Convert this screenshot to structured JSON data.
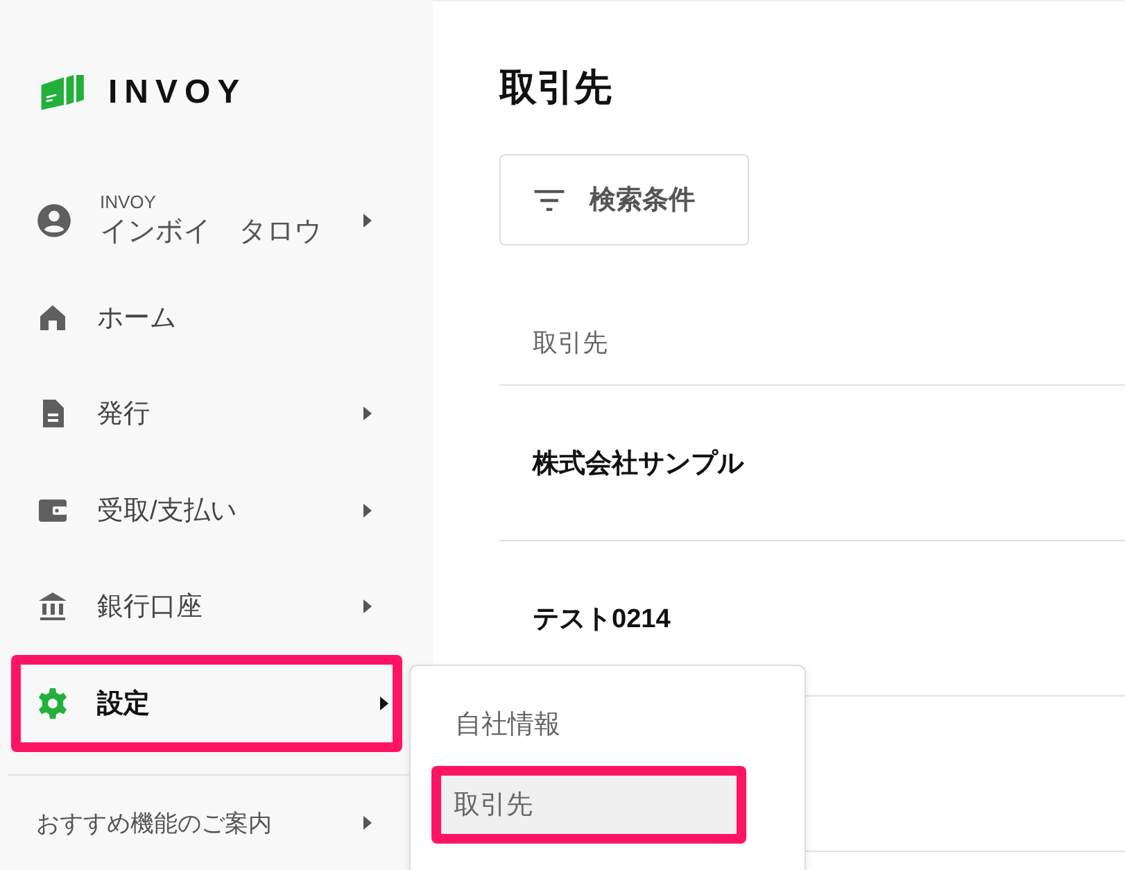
{
  "logo": {
    "text": "INVOY"
  },
  "account": {
    "company": "INVOY",
    "name": "インボイ　タロウ",
    "has_submenu": true
  },
  "nav": [
    {
      "label": "ホーム",
      "kind": "home",
      "has_submenu": false,
      "active": false,
      "highlighted": false
    },
    {
      "label": "発行",
      "kind": "document",
      "has_submenu": true,
      "active": false,
      "highlighted": false
    },
    {
      "label": "受取/支払い",
      "kind": "wallet",
      "has_submenu": true,
      "active": false,
      "highlighted": false
    },
    {
      "label": "銀行口座",
      "kind": "bank",
      "has_submenu": true,
      "active": false,
      "highlighted": false
    },
    {
      "label": "設定",
      "kind": "settings",
      "has_submenu": true,
      "active": true,
      "highlighted": true
    }
  ],
  "promo": {
    "label": "おすすめ機能のご案内",
    "has_submenu": true
  },
  "submenu": {
    "items": [
      {
        "label": "自社情報",
        "selected": false,
        "highlighted": false
      },
      {
        "label": "取引先",
        "selected": true,
        "highlighted": true
      }
    ]
  },
  "page": {
    "title": "取引先",
    "filter_button": "検索条件",
    "table": {
      "column": "取引先",
      "rows": [
        "株式会社サンプル",
        "テスト0214"
      ]
    }
  }
}
